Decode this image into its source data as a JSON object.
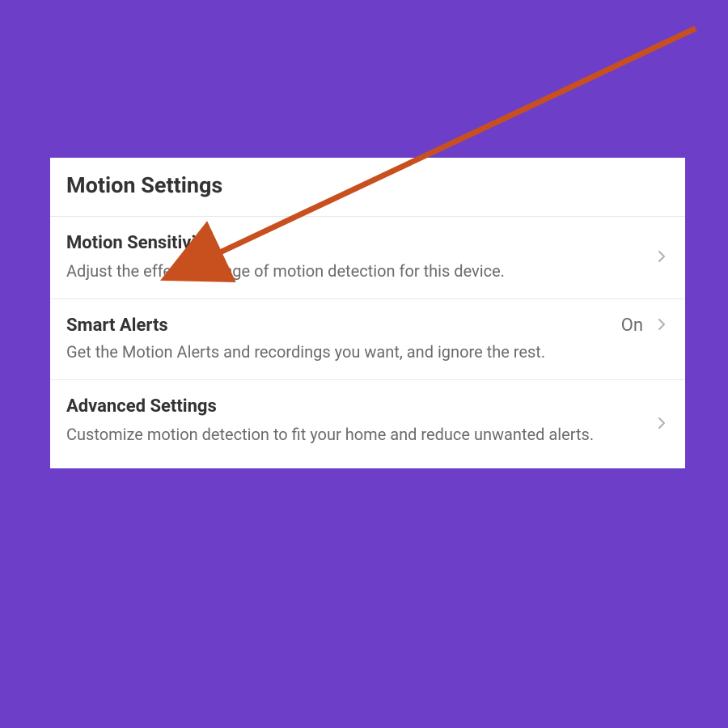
{
  "panel": {
    "title": "Motion Settings"
  },
  "rows": [
    {
      "title": "Motion Sensitivity",
      "description": "Adjust the effective range of motion detection for this device.",
      "status": ""
    },
    {
      "title": "Smart Alerts",
      "description": "Get the Motion Alerts and recordings you want, and ignore the rest.",
      "status": "On"
    },
    {
      "title": "Advanced Settings",
      "description": "Customize motion detection to fit your home and reduce unwanted alerts.",
      "status": ""
    }
  ],
  "colors": {
    "background": "#6d3fc8",
    "arrow": "#c8501f"
  }
}
